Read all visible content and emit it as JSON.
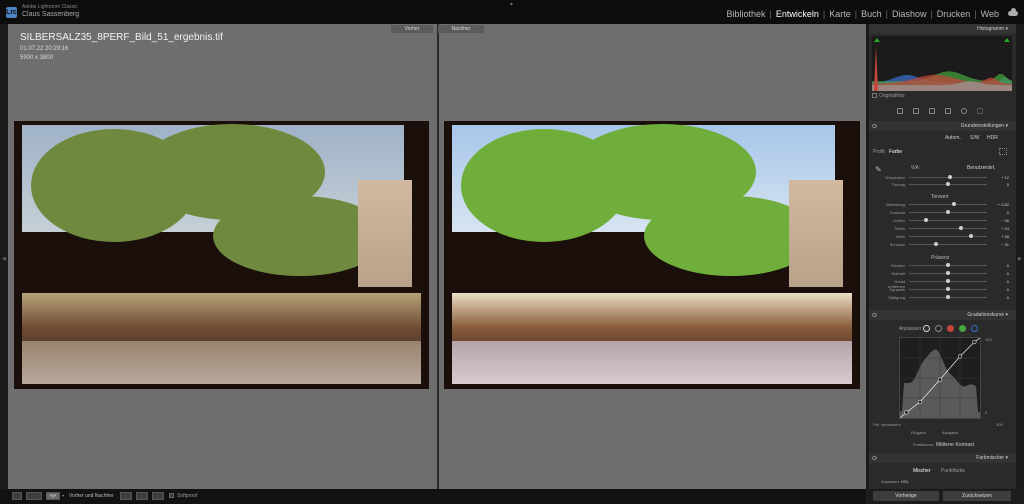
{
  "titlebar": {
    "logo_text": "Lrc",
    "app_name": "Adobe Lightroom Classic",
    "user_name": "Claus Sassenberg",
    "modules": [
      {
        "label": "Bibliothek",
        "active": false
      },
      {
        "label": "Entwickeln",
        "active": true
      },
      {
        "label": "Karte",
        "active": false
      },
      {
        "label": "Buch",
        "active": false
      },
      {
        "label": "Diashow",
        "active": false
      },
      {
        "label": "Drucken",
        "active": false
      },
      {
        "label": "Web",
        "active": false
      }
    ],
    "separator": "|"
  },
  "canvas": {
    "label_before": "Vorher",
    "label_after": "Nachher",
    "file_name": "SILBERSALZ35_8PERF_Bild_51_ergebnis.tif",
    "file_date": "01.07.22 20:29:16",
    "file_dims": "5900 x 3800"
  },
  "toolbar": {
    "view_active_label": "Y|Y",
    "view_label": "Vorher und Nachher",
    "softproof_label": "Softproof"
  },
  "panel": {
    "histogram": {
      "title": "Histogramm",
      "original_label": "Originalfoto",
      "colors": {
        "red": "#c8443c",
        "green": "#46a640",
        "blue": "#3a6fd0",
        "gray": "#9a9a9a"
      }
    },
    "basic": {
      "title": "Grundeinstellungen",
      "modes": [
        "Autom.",
        "S/W",
        "HDR"
      ],
      "profile_label": "Profil:",
      "profile_value": "Farbe",
      "wb_label": "WA:",
      "wb_value": "Benutzerdef.",
      "tone_label": "Tonwert",
      "presence_label": "Präsenz",
      "sliders_wb": [
        {
          "label": "Temperatur",
          "value": "+ 12",
          "pos": 0.52
        },
        {
          "label": "Tönung",
          "value": "0",
          "pos": 0.5
        }
      ],
      "sliders_tone": [
        {
          "label": "Belichtung",
          "value": "+ 0,82",
          "pos": 0.58
        },
        {
          "label": "Kontrast",
          "value": "0",
          "pos": 0.5
        },
        {
          "label": "Lichter",
          "value": "− 56",
          "pos": 0.22
        },
        {
          "label": "Tiefen",
          "value": "+ 34",
          "pos": 0.67
        },
        {
          "label": "Weiß",
          "value": "+ 58",
          "pos": 0.79
        },
        {
          "label": "Schwarz",
          "value": "− 31",
          "pos": 0.35
        }
      ],
      "sliders_presence": [
        {
          "label": "Struktur",
          "value": "0",
          "pos": 0.5
        },
        {
          "label": "Klarheit",
          "value": "0",
          "pos": 0.5
        },
        {
          "label": "Dunst entfernen",
          "value": "0",
          "pos": 0.5
        },
        {
          "label": "Dynamik",
          "value": "0",
          "pos": 0.5
        },
        {
          "label": "Sättigung",
          "value": "0",
          "pos": 0.5
        }
      ]
    },
    "curve": {
      "title": "Gradationskurve",
      "adjust_label": "Anpassen:",
      "top_value": "100",
      "bottom_value": "0",
      "right_value": "100",
      "edit_label": "Pkt. verbessern",
      "x_labels": [
        "Eingabe:",
        "Ausgabe:"
      ],
      "point_curve_label": "Punktkurve:",
      "point_curve_value": "Mittlerer Kontrast",
      "channel_colors": [
        "#d8d8d8",
        "#c8443c",
        "#46a640",
        "#3a6fd0"
      ],
      "points": [
        [
          0.08,
          0.07
        ],
        [
          0.25,
          0.2
        ],
        [
          0.5,
          0.48
        ],
        [
          0.75,
          0.77
        ],
        [
          0.93,
          0.95
        ]
      ]
    },
    "mixer": {
      "title": "Farbmischer",
      "tab_active": "Mischer",
      "tab_other": "Punktfarbe",
      "row_label": "Anpassen:",
      "row_value": "HSL"
    },
    "footer": {
      "prev_label": "Vorherige",
      "reset_label": "Zurücksetzen"
    }
  }
}
